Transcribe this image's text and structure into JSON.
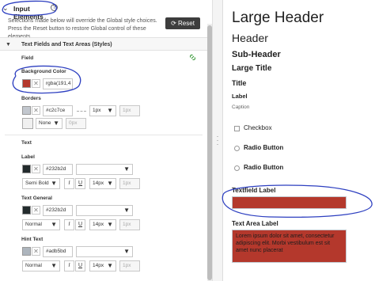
{
  "settings": {
    "section_title": "Input Elements",
    "help_glyph": "?",
    "description": "Selections made below will override the Global style choices. Press the Reset button to restore Global control of these elements.",
    "reset_label": "Reset",
    "reset_glyph": "⟳",
    "subsection_title": "Text Fields and Text Areas (Styles)",
    "field_label": "Field",
    "background_color_label": "Background Color",
    "background_color_value": "rgba(191,4",
    "background_swatch": "#b4382c",
    "borders_label": "Borders",
    "border_color_value": "#c2c7ce",
    "border_swatch": "#c2c7ce",
    "border_width": "1px",
    "border_width_placeholder": "1px",
    "border_style": "None",
    "border_radius_placeholder": "0px",
    "text_label": "Text",
    "label_label": "Label",
    "label_color": "#232b2d",
    "label_swatch": "#232b2d",
    "label_weight": "Semi Bold",
    "label_size": "14px",
    "label_size_placeholder": "1px",
    "text_general_label": "Text General",
    "general_color": "#232b2d",
    "general_swatch": "#232b2d",
    "general_weight": "Normal",
    "general_size": "14px",
    "general_size_placeholder": "1px",
    "hint_text_label": "Hint Text",
    "hint_color": "#adb5bd",
    "hint_swatch": "#adb5bd",
    "hint_weight": "Normal",
    "hint_size": "14px",
    "hint_size_placeholder": "1px",
    "italic_glyph": "I",
    "underline_glyph": "U",
    "clear_glyph": "✕",
    "dropdown_glyph": "▼"
  },
  "preview": {
    "large_header": "Large Header",
    "header": "Header",
    "sub_header": "Sub-Header",
    "large_title": "Large Title",
    "title": "Title",
    "label": "Label",
    "caption": "Caption",
    "checkbox": "Checkbox",
    "radio_button_1": "Radio Button",
    "radio_button_2": "Radio Button",
    "textfield_label": "Textfield Label",
    "text_area_label": "Text Area Label",
    "text_area_value": "Lorem ipsum dolor sit amet, consectetur adipiscing elit. Morbi vestibulum est sit amet nunc placerat"
  },
  "colors": {
    "field_background": "#b4382c",
    "annotation": "#2d3fc0"
  }
}
